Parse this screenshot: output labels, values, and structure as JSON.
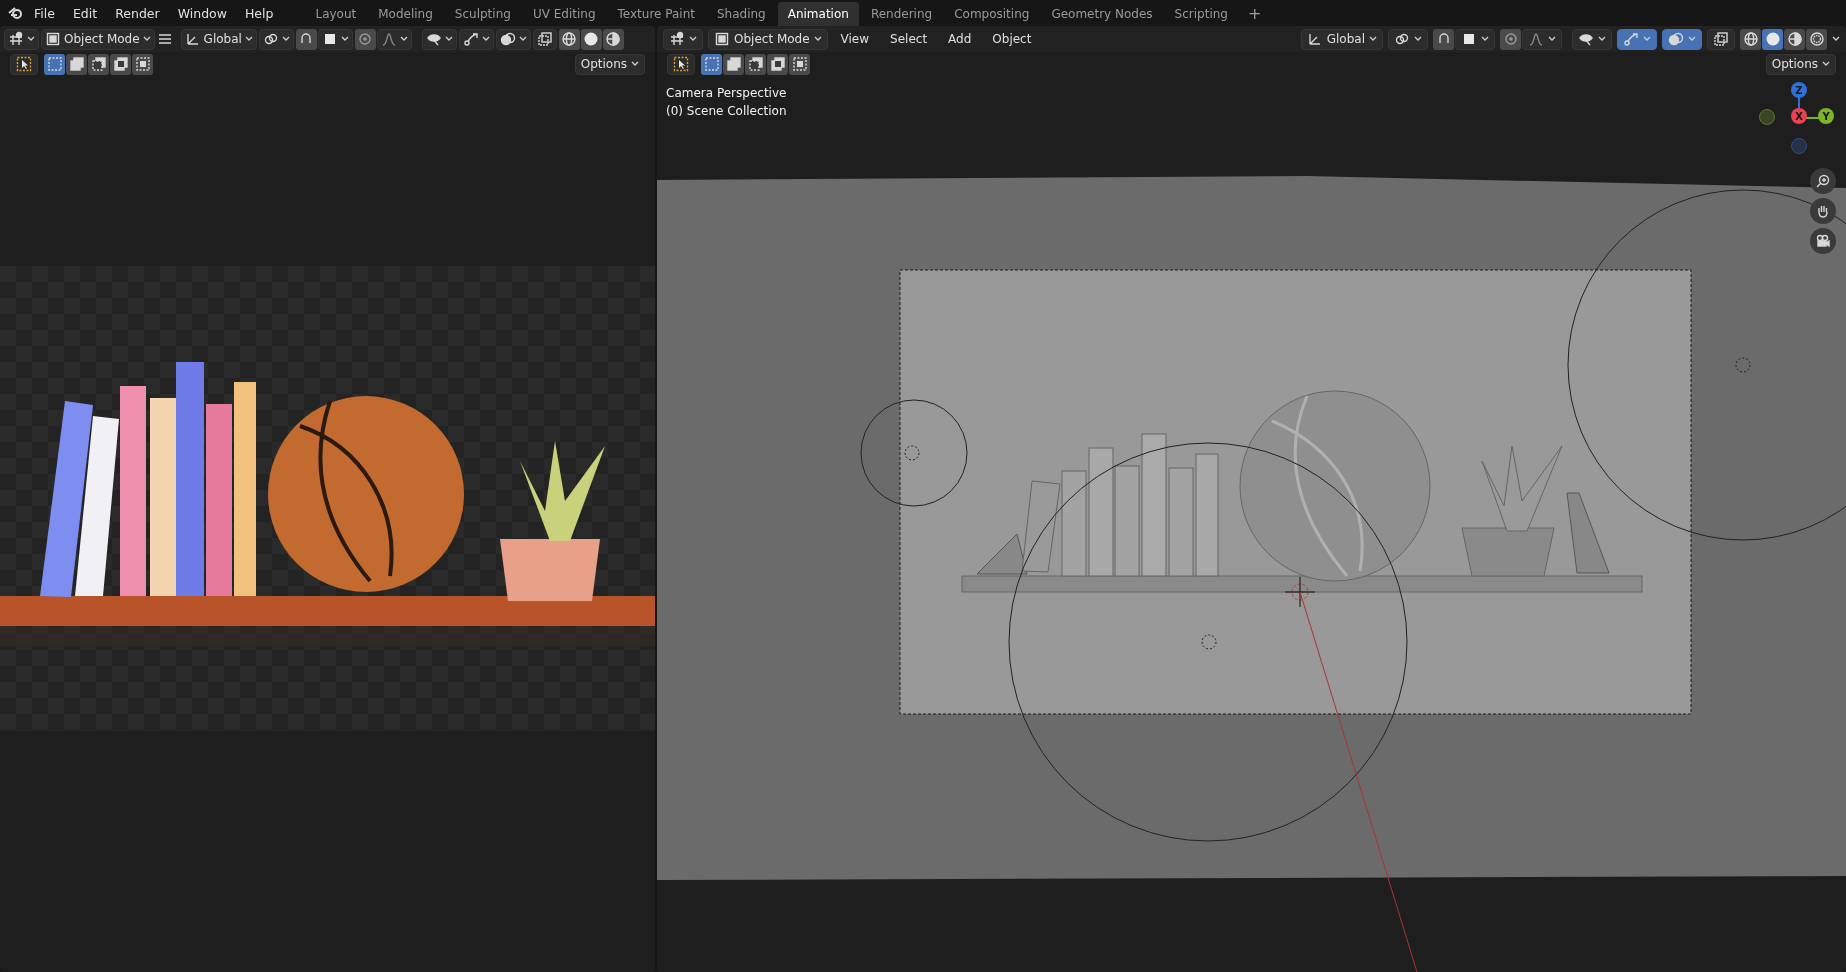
{
  "top_menu": [
    "File",
    "Edit",
    "Render",
    "Window",
    "Help"
  ],
  "workspace_tabs": [
    {
      "label": "Layout",
      "selected": false
    },
    {
      "label": "Modeling",
      "selected": false
    },
    {
      "label": "Sculpting",
      "selected": false
    },
    {
      "label": "UV Editing",
      "selected": false
    },
    {
      "label": "Texture Paint",
      "selected": false
    },
    {
      "label": "Shading",
      "selected": false
    },
    {
      "label": "Animation",
      "selected": true
    },
    {
      "label": "Rendering",
      "selected": false
    },
    {
      "label": "Compositing",
      "selected": false
    },
    {
      "label": "Geometry Nodes",
      "selected": false
    },
    {
      "label": "Scripting",
      "selected": false
    }
  ],
  "add_workspace": "+",
  "left_editor": {
    "mode": "Object Mode",
    "orientation": "Global",
    "gizmos_on": false,
    "overlays_on": false,
    "selection_modes": [
      {
        "kind": "set",
        "selected": true
      },
      {
        "kind": "extend",
        "selected": false
      },
      {
        "kind": "subtract",
        "selected": false
      },
      {
        "kind": "difference",
        "selected": false
      },
      {
        "kind": "intersect",
        "selected": false
      }
    ],
    "shading_modes": [
      {
        "kind": "wireframe",
        "selected": false
      },
      {
        "kind": "solid",
        "selected": false
      },
      {
        "kind": "material",
        "selected": false
      }
    ],
    "options": "Options"
  },
  "viewport": {
    "mode": "Object Mode",
    "menus": [
      "View",
      "Select",
      "Add",
      "Object"
    ],
    "orientation": "Global",
    "gizmos_on": true,
    "overlays_on": true,
    "selection_modes": [
      {
        "kind": "set",
        "selected": true
      },
      {
        "kind": "extend",
        "selected": false
      },
      {
        "kind": "subtract",
        "selected": false
      },
      {
        "kind": "difference",
        "selected": false
      },
      {
        "kind": "intersect",
        "selected": false
      }
    ],
    "shading_modes": [
      {
        "kind": "wireframe",
        "selected": false
      },
      {
        "kind": "solid",
        "selected": true
      },
      {
        "kind": "material",
        "selected": false
      },
      {
        "kind": "rendered",
        "selected": false
      }
    ],
    "options": "Options",
    "overlay_text": [
      "Camera Perspective",
      "(0) Scene Collection"
    ],
    "axes": [
      {
        "label": "Z",
        "color": "#2f6fd8"
      },
      {
        "label": "X",
        "color": "#e8414f"
      },
      {
        "label": "Y",
        "color": "#7cb42a"
      }
    ]
  }
}
